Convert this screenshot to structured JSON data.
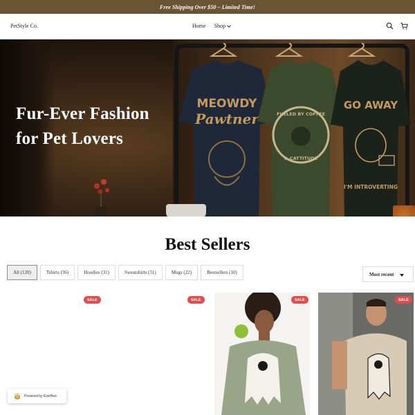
{
  "announcement": {
    "text": "Free Shipping Over $50 – Limited Time!"
  },
  "header": {
    "logo": "PetStyle Co.",
    "nav": [
      {
        "label": "Home"
      },
      {
        "label": "Shop"
      }
    ],
    "icons": [
      "search-icon",
      "cart-icon"
    ]
  },
  "hero": {
    "title_line1": "Fur-Ever Fashion",
    "title_line2": "for Pet Lovers",
    "shirts": [
      {
        "text_top": "MEOWDY",
        "text_bottom": "Pawtner",
        "color": "#1f2a3a"
      },
      {
        "text_top": "FUELED BY COFFEE",
        "text_bottom": "& CATTITUDE",
        "color": "#3a4a2b"
      },
      {
        "text_top": "GO AWAY",
        "text_bottom": "I'M INTROVERTING",
        "color": "#1d241c"
      }
    ]
  },
  "best_sellers": {
    "heading": "Best Sellers",
    "filters": [
      {
        "label": "All (120)",
        "active": true
      },
      {
        "label": "Tshirts (36)",
        "active": false
      },
      {
        "label": "Hoodies (31)",
        "active": false
      },
      {
        "label": "Sweatshirts (31)",
        "active": false
      },
      {
        "label": "Mugs (22)",
        "active": false
      },
      {
        "label": "Bestsellers (10)",
        "active": false
      }
    ],
    "sort": {
      "selected": "Most recent"
    },
    "products": [
      {
        "badge": "SALE"
      },
      {
        "badge": "SALE"
      },
      {
        "badge": "SALE"
      },
      {
        "badge": "SALE"
      }
    ]
  },
  "powered_by": {
    "text": "Powered by EverBee"
  },
  "colors": {
    "announcement_bg": "#6b5433",
    "sale_badge": "#e64b4b"
  }
}
